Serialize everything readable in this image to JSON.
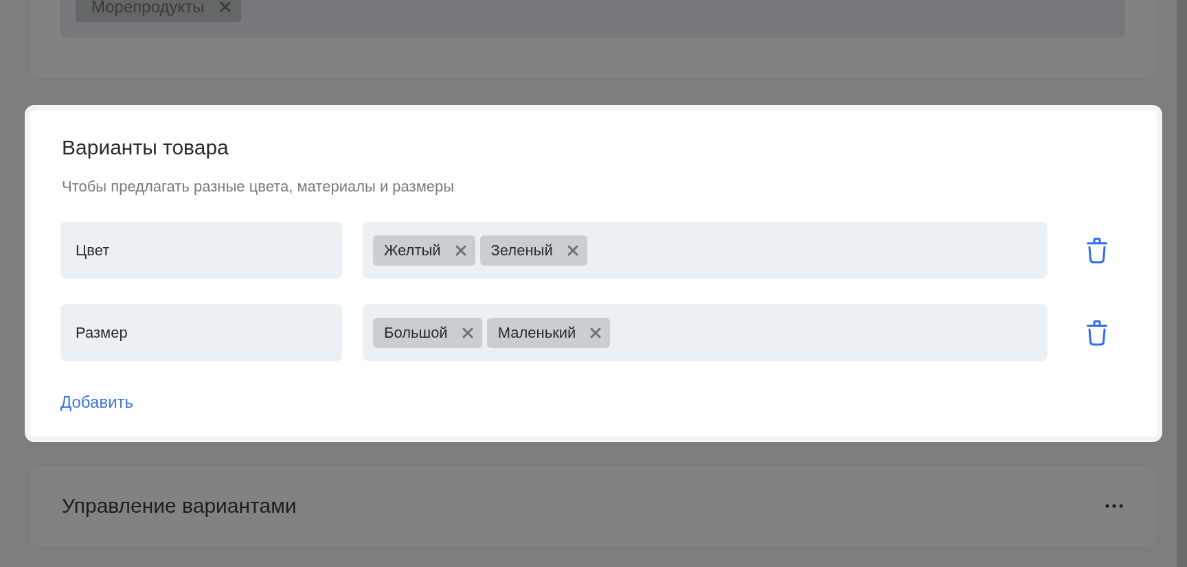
{
  "top_section": {
    "tags": [
      "Морепродукты"
    ]
  },
  "variants_card": {
    "title": "Варианты товара",
    "subtitle": "Чтобы предлагать разные цвета, материалы и размеры",
    "options": [
      {
        "name": "Цвет",
        "values": [
          "Желтый",
          "Зеленый"
        ]
      },
      {
        "name": "Размер",
        "values": [
          "Большой",
          "Маленький"
        ]
      }
    ],
    "add_link": "Добавить"
  },
  "bottom_section": {
    "title": "Управление вариантами"
  }
}
